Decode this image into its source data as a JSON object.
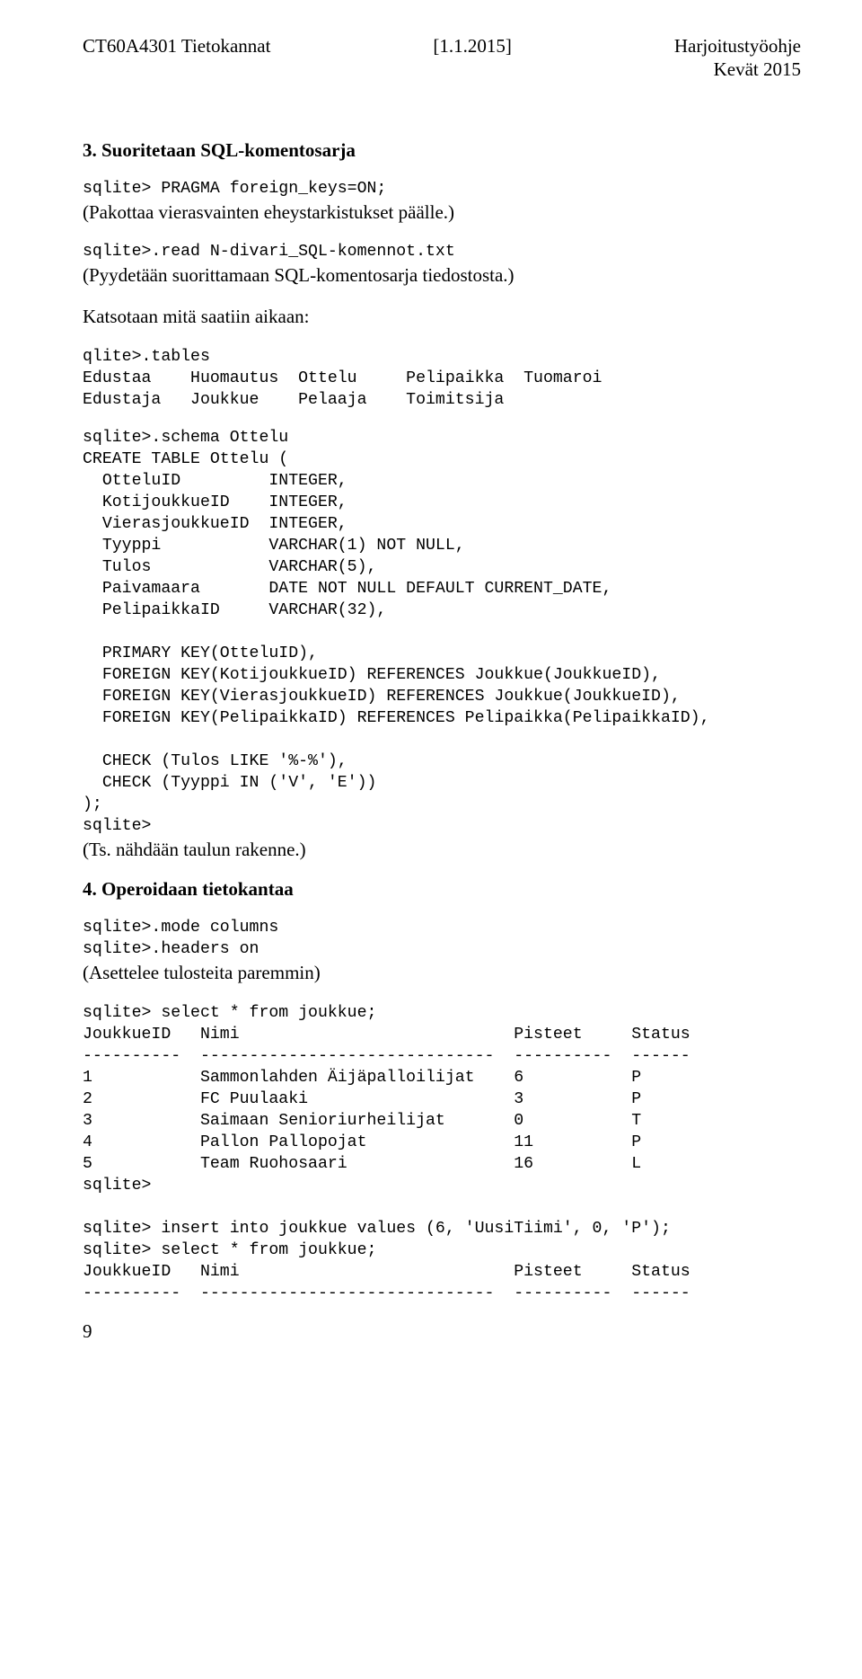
{
  "header": {
    "left": "CT60A4301 Tietokannat",
    "mid": "[1.1.2015]",
    "right1": "Harjoitustyöohje",
    "right2": "Kevät 2015"
  },
  "sec3_title": "3. Suoritetaan SQL-komentosarja",
  "p1_line1": "sqlite> PRAGMA foreign_keys=ON;",
  "p1_note": "(Pakottaa vierasvainten eheystarkistukset päälle.)",
  "p2_line1": "sqlite>.read N-divari_SQL-komennot.txt",
  "p2_note": "(Pyydetään suorittamaan SQL-komentosarja tiedostosta.)",
  "p3_intro": "Katsotaan mitä saatiin aikaan:",
  "tables_block": "qlite>.tables\nEdustaa    Huomautus  Ottelu     Pelipaikka  Tuomaroi\nEdustaja   Joukkue    Pelaaja    Toimitsija",
  "schema_block": "sqlite>.schema Ottelu\nCREATE TABLE Ottelu (\n  OtteluID         INTEGER,\n  KotijoukkueID    INTEGER,\n  VierasjoukkueID  INTEGER,\n  Tyyppi           VARCHAR(1) NOT NULL,\n  Tulos            VARCHAR(5),\n  Paivamaara       DATE NOT NULL DEFAULT CURRENT_DATE,\n  PelipaikkaID     VARCHAR(32),\n\n  PRIMARY KEY(OtteluID),\n  FOREIGN KEY(KotijoukkueID) REFERENCES Joukkue(JoukkueID),\n  FOREIGN KEY(VierasjoukkueID) REFERENCES Joukkue(JoukkueID),\n  FOREIGN KEY(PelipaikkaID) REFERENCES Pelipaikka(PelipaikkaID),\n\n  CHECK (Tulos LIKE '%-%'),\n  CHECK (Tyyppi IN ('V', 'E'))\n);\nsqlite>",
  "schema_note": "(Ts. nähdään taulun rakenne.)",
  "sec4_title": "4. Operoidaan tietokantaa",
  "mode_block": "sqlite>.mode columns\nsqlite>.headers on",
  "mode_note": "(Asettelee tulosteita paremmin)",
  "select_block": "sqlite> select * from joukkue;\nJoukkueID   Nimi                            Pisteet     Status\n----------  ------------------------------  ----------  ------\n1           Sammonlahden Äijäpalloilijat    6           P\n2           FC Puulaaki                     3           P\n3           Saimaan Senioriurheilijat       0           T\n4           Pallon Pallopojat               11          P\n5           Team Ruohosaari                 16          L\nsqlite>\n\nsqlite> insert into joukkue values (6, 'UusiTiimi', 0, 'P');\nsqlite> select * from joukkue;\nJoukkueID   Nimi                            Pisteet     Status\n----------  ------------------------------  ----------  ------",
  "page_number": "9"
}
